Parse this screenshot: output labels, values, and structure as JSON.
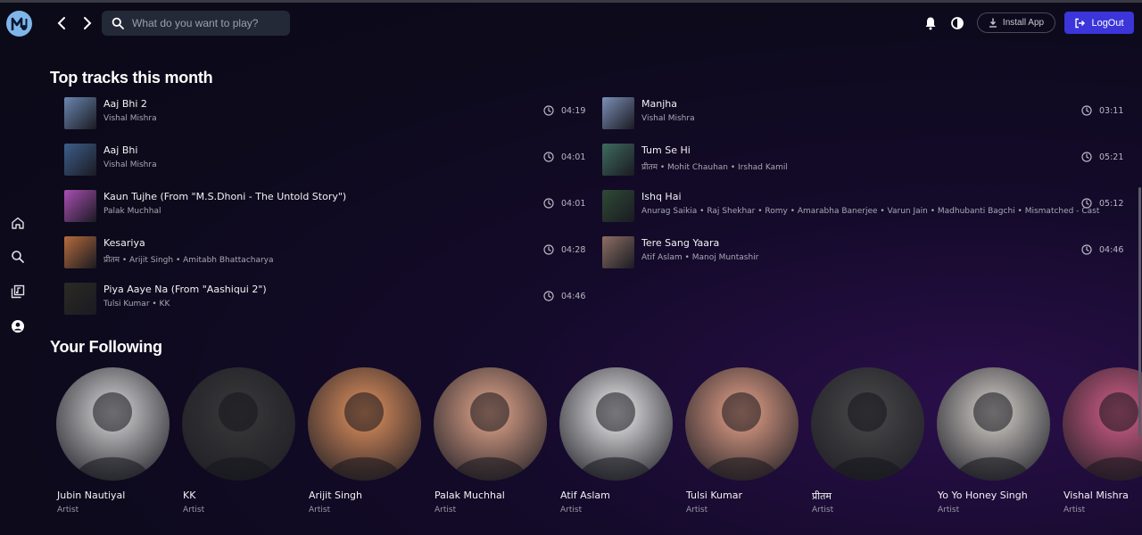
{
  "search": {
    "placeholder": "What do you want to play?"
  },
  "header": {
    "install_label": "Install App",
    "logout_label": "LogOut"
  },
  "sidebar": [
    "home-icon",
    "search-icon",
    "library-icon",
    "profile-icon"
  ],
  "top_tracks": {
    "title": "Top tracks this month",
    "left": [
      {
        "title": "Aaj Bhi 2",
        "artist": "Vishal Mishra",
        "duration": "04:19",
        "color": "#6a86b0"
      },
      {
        "title": "Aaj Bhi",
        "artist": "Vishal Mishra",
        "duration": "04:01",
        "color": "#3d5e8a"
      },
      {
        "title": "Kaun Tujhe (From \"M.S.Dhoni - The Untold Story\")",
        "artist": "Palak Muchhal",
        "duration": "04:01",
        "color": "#a94fb3"
      },
      {
        "title": "Kesariya",
        "artist": "प्रीतम • Arijit Singh • Amitabh Bhattacharya",
        "duration": "04:28",
        "color": "#b56b3c"
      },
      {
        "title": "Piya Aaye Na (From \"Aashiqui 2\")",
        "artist": "Tulsi Kumar • KK",
        "duration": "04:46",
        "color": "#2b2a24"
      }
    ],
    "right": [
      {
        "title": "Manjha",
        "artist": "Vishal Mishra",
        "duration": "03:11",
        "color": "#7c8fb6"
      },
      {
        "title": "Tum Se Hi",
        "artist": "प्रीतम • Mohit Chauhan • Irshad Kamil",
        "duration": "05:21",
        "color": "#3f6b5e"
      },
      {
        "title": "Ishq Hai",
        "artist": "Anurag Saikia • Raj Shekhar • Romy • Amarabha Banerjee • Varun Jain • Madhubanti Bagchi • Mismatched - Cast",
        "duration": "05:12",
        "color": "#2f4a35"
      },
      {
        "title": "Tere Sang Yaara",
        "artist": "Atif Aslam • Manoj Muntashir",
        "duration": "04:46",
        "color": "#8d6f64"
      }
    ]
  },
  "following": {
    "title": "Your Following",
    "artists": [
      {
        "name": "Jubin Nautiyal",
        "role": "Artist",
        "color": "#d9d9d9"
      },
      {
        "name": "KK",
        "role": "Artist",
        "color": "#3a3a3a"
      },
      {
        "name": "Arijit Singh",
        "role": "Artist",
        "color": "#e4935f"
      },
      {
        "name": "Palak Muchhal",
        "role": "Artist",
        "color": "#e7a98d"
      },
      {
        "name": "Atif Aslam",
        "role": "Artist",
        "color": "#f0f0f0"
      },
      {
        "name": "Tulsi Kumar",
        "role": "Artist",
        "color": "#e9a48a"
      },
      {
        "name": "प्रीतम",
        "role": "Artist",
        "color": "#4a4a4a"
      },
      {
        "name": "Yo Yo Honey Singh",
        "role": "Artist",
        "color": "#d7d3cc"
      },
      {
        "name": "Vishal Mishra",
        "role": "Artist",
        "color": "#d55f87"
      }
    ]
  }
}
